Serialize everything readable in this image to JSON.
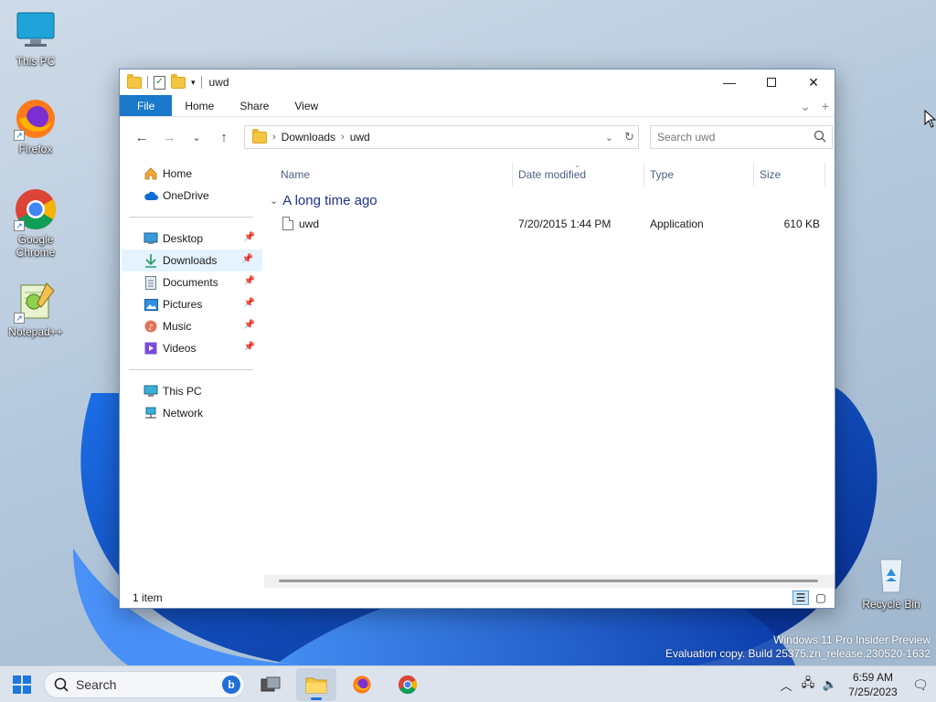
{
  "desktop": {
    "icons": [
      {
        "label": "This PC"
      },
      {
        "label": "Firefox"
      },
      {
        "label": "Google Chrome"
      },
      {
        "label": "Notepad++"
      },
      {
        "label": "Recycle Bin"
      }
    ]
  },
  "window": {
    "title": "uwd",
    "ribbon_tabs": [
      "File",
      "Home",
      "Share",
      "View"
    ],
    "address": {
      "crumbs": [
        "Downloads",
        "uwd"
      ]
    },
    "search_placeholder": "Search uwd",
    "sidebar": {
      "quick": [
        {
          "label": "Home"
        },
        {
          "label": "OneDrive"
        }
      ],
      "pinned": [
        {
          "label": "Desktop"
        },
        {
          "label": "Downloads"
        },
        {
          "label": "Documents"
        },
        {
          "label": "Pictures"
        },
        {
          "label": "Music"
        },
        {
          "label": "Videos"
        }
      ],
      "devices": [
        {
          "label": "This PC"
        },
        {
          "label": "Network"
        }
      ]
    },
    "columns": [
      "Name",
      "Date modified",
      "Type",
      "Size"
    ],
    "group": "A long time ago",
    "files": [
      {
        "name": "uwd",
        "date": "7/20/2015 1:44 PM",
        "type": "Application",
        "size": "610 KB"
      }
    ],
    "status": "1 item"
  },
  "watermark": {
    "line1": "Windows 11 Pro Insider Preview",
    "line2": "Evaluation copy. Build 25375.zn_release.230520-1632"
  },
  "taskbar": {
    "search_label": "Search",
    "time": "6:59 AM",
    "date": "7/25/2023"
  },
  "colors": {
    "accent": "#1979ca",
    "group_text": "#1e3287",
    "selected_bg": "#e5f3ff"
  }
}
